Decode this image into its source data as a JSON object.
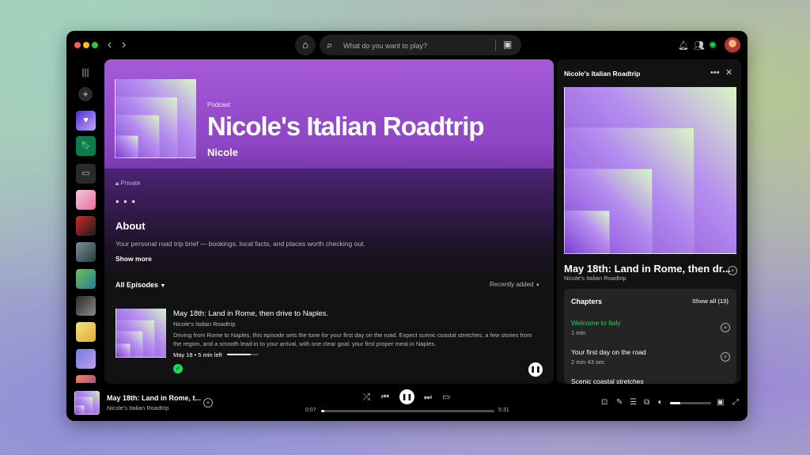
{
  "topbar": {
    "search_placeholder": "What do you want to play?",
    "icons": [
      "back-arrow-icon",
      "forward-arrow-icon",
      "home-icon",
      "search-icon",
      "browse-icon",
      "bell-icon",
      "friends-icon",
      "spotify-logo-icon",
      "avatar"
    ]
  },
  "podcast": {
    "label": "Podcast",
    "title": "Nicole's Italian Roadtrip",
    "author": "Nicole",
    "privacy": "Private",
    "more": "• • •",
    "about_title": "About",
    "about_text": "Your personal road trip brief — bookings, local facts, and places worth checking out.",
    "show_more": "Show more",
    "episodes_filter": "All Episodes",
    "sort_label": "Recently added"
  },
  "episode": {
    "title": "May 18th: Land in Rome, then drive to Naples.",
    "show": "Nicole's Italian Roadtrip",
    "description": "Driving from Rome to Naples, this episode sets the tone for your first day on the road. Expect scenic coastal stretches, a few stories from the region, and a smooth lead-in to your arrival, with one clear goal: your first proper meal in Naples.",
    "meta": "May 18 • 5 min left",
    "progress": 0.75
  },
  "now_playing_panel": {
    "header": "Nicole's Italian Roadtrip",
    "episode_title": "May 18th: Land in Rome, then dr...",
    "episode_show": "Nicole's Italian Roadtrip",
    "chapters_title": "Chapters",
    "show_all": "Show all (13)",
    "chapters": [
      {
        "name": "Welcome to Italy",
        "duration": "1 min",
        "active": true
      },
      {
        "name": "Your first day on the road",
        "duration": "2 min 43 sec",
        "active": false
      },
      {
        "name": "Scenic coastal stretches",
        "duration": "",
        "active": false
      }
    ]
  },
  "player": {
    "title": "May 18th: Land in Rome, t...",
    "show": "Nicole's Italian Roadtrip",
    "elapsed": "0:07",
    "total": "5:31",
    "progress": 0.02,
    "volume": 0.25
  },
  "colors": {
    "accent_green": "#1ed760",
    "hero_purple": "#a65ad8",
    "cover_purple": "#6f2fc2",
    "cover_green": "#c9f3b0"
  }
}
